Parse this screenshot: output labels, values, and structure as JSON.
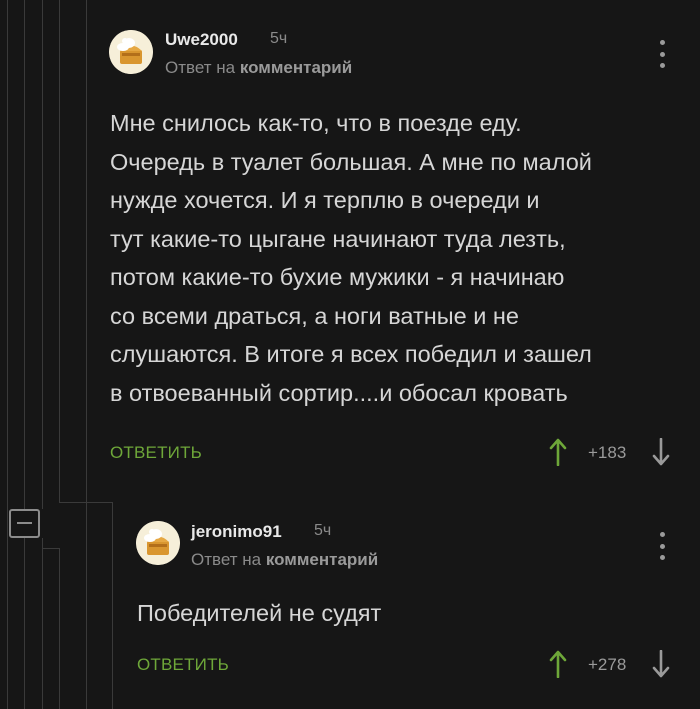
{
  "comment": {
    "username": "Uwe2000",
    "time": "5ч",
    "reply_prefix": "Ответ на",
    "reply_target": "комментарий",
    "text": "Мне снилось как-то, что в поезде еду.\nОчередь в туалет большая. А мне по малой\nнужде хочется.  И я терплю в очереди и\nтут какие-то цыгане начинают туда лезть,\nпотом какие-то бухие мужики - я начинаю\nсо всеми драться, а ноги ватные и не\nслушаются. В итоге я всех победил и зашел\nв отвоеванный сортир....и обосал кровать",
    "reply_label": "ОТВЕТИТЬ",
    "rating": "+183"
  },
  "reply": {
    "username": "jeronimo91",
    "time": "5ч",
    "reply_prefix": "Ответ на",
    "reply_target": "комментарий",
    "text": "Победителей не судят",
    "reply_label": "ОТВЕТИТЬ",
    "rating": "+278"
  },
  "icons": {
    "collapse": "minus-square-icon",
    "more": "vertical-dots-icon",
    "upvote": "arrow-up-icon",
    "downvote": "arrow-down-icon"
  },
  "colors": {
    "background": "#161616",
    "accent_green": "#6ea739",
    "text": "#d6d6d6",
    "muted": "#8a8a8a"
  }
}
